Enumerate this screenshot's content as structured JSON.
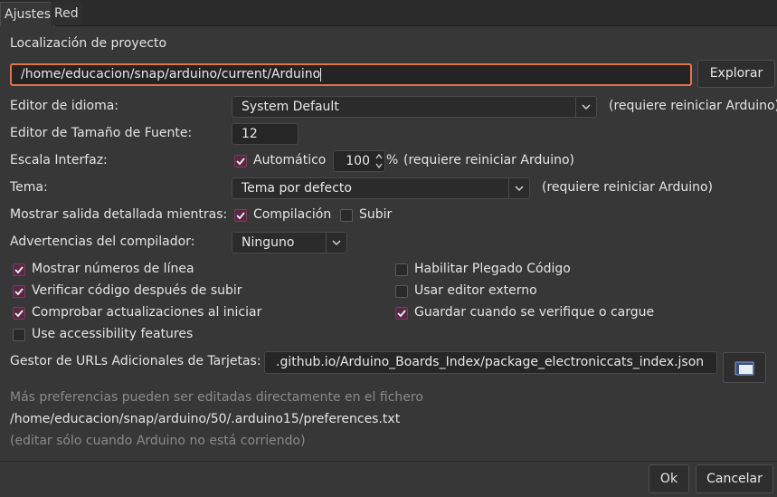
{
  "tabs": [
    "Ajustes",
    "Red"
  ],
  "project": {
    "label": "Localización de proyecto",
    "path": "/home/educacion/snap/arduino/current/Arduino",
    "browse": "Explorar"
  },
  "language": {
    "label": "Editor de idioma:",
    "value": "System Default",
    "note": "(requiere reiniciar Arduino)"
  },
  "fontsize": {
    "label": "Editor de Tamaño de Fuente:",
    "value": "12"
  },
  "scale": {
    "label": "Escala Interfaz:",
    "auto_label": "Automático",
    "auto_checked": true,
    "value": "100",
    "unit": "%",
    "note": "(requiere reiniciar Arduino)"
  },
  "theme": {
    "label": "Tema:",
    "value": "Tema por defecto",
    "note": "(requiere reiniciar Arduino)"
  },
  "verbose": {
    "label": "Mostrar salida detallada mientras:",
    "compile_label": "Compilación",
    "compile_checked": true,
    "upload_label": "Subir",
    "upload_checked": false
  },
  "warnings": {
    "label": "Advertencias del compilador:",
    "value": "Ninguno"
  },
  "options_left": [
    {
      "label": "Mostrar números de línea",
      "checked": true
    },
    {
      "label": "Verificar código después de subir",
      "checked": true
    },
    {
      "label": "Comprobar actualizaciones al iniciar",
      "checked": true
    },
    {
      "label": "Use accessibility features",
      "checked": false
    }
  ],
  "options_right": [
    {
      "label": "Habilitar Plegado Código",
      "checked": false
    },
    {
      "label": "Usar editor externo",
      "checked": false
    },
    {
      "label": "Guardar cuando se verifique o cargue",
      "checked": true
    }
  ],
  "boards_url": {
    "label": "Gestor de URLs Adicionales de Tarjetas:",
    "value": ".github.io/Arduino_Boards_Index/package_electroniccats_index.json",
    "button_icon": "window-icon"
  },
  "footer": {
    "more_prefs": "Más preferencias pueden ser editadas directamente en el fichero",
    "prefs_path": "/home/educacion/snap/arduino/50/.arduino15/preferences.txt",
    "edit_note": "(editar sólo cuando Arduino no está corriendo)"
  },
  "buttons": {
    "ok": "Ok",
    "cancel": "Cancelar"
  },
  "colors": {
    "accent": "#e0734c",
    "check": "#582844"
  }
}
